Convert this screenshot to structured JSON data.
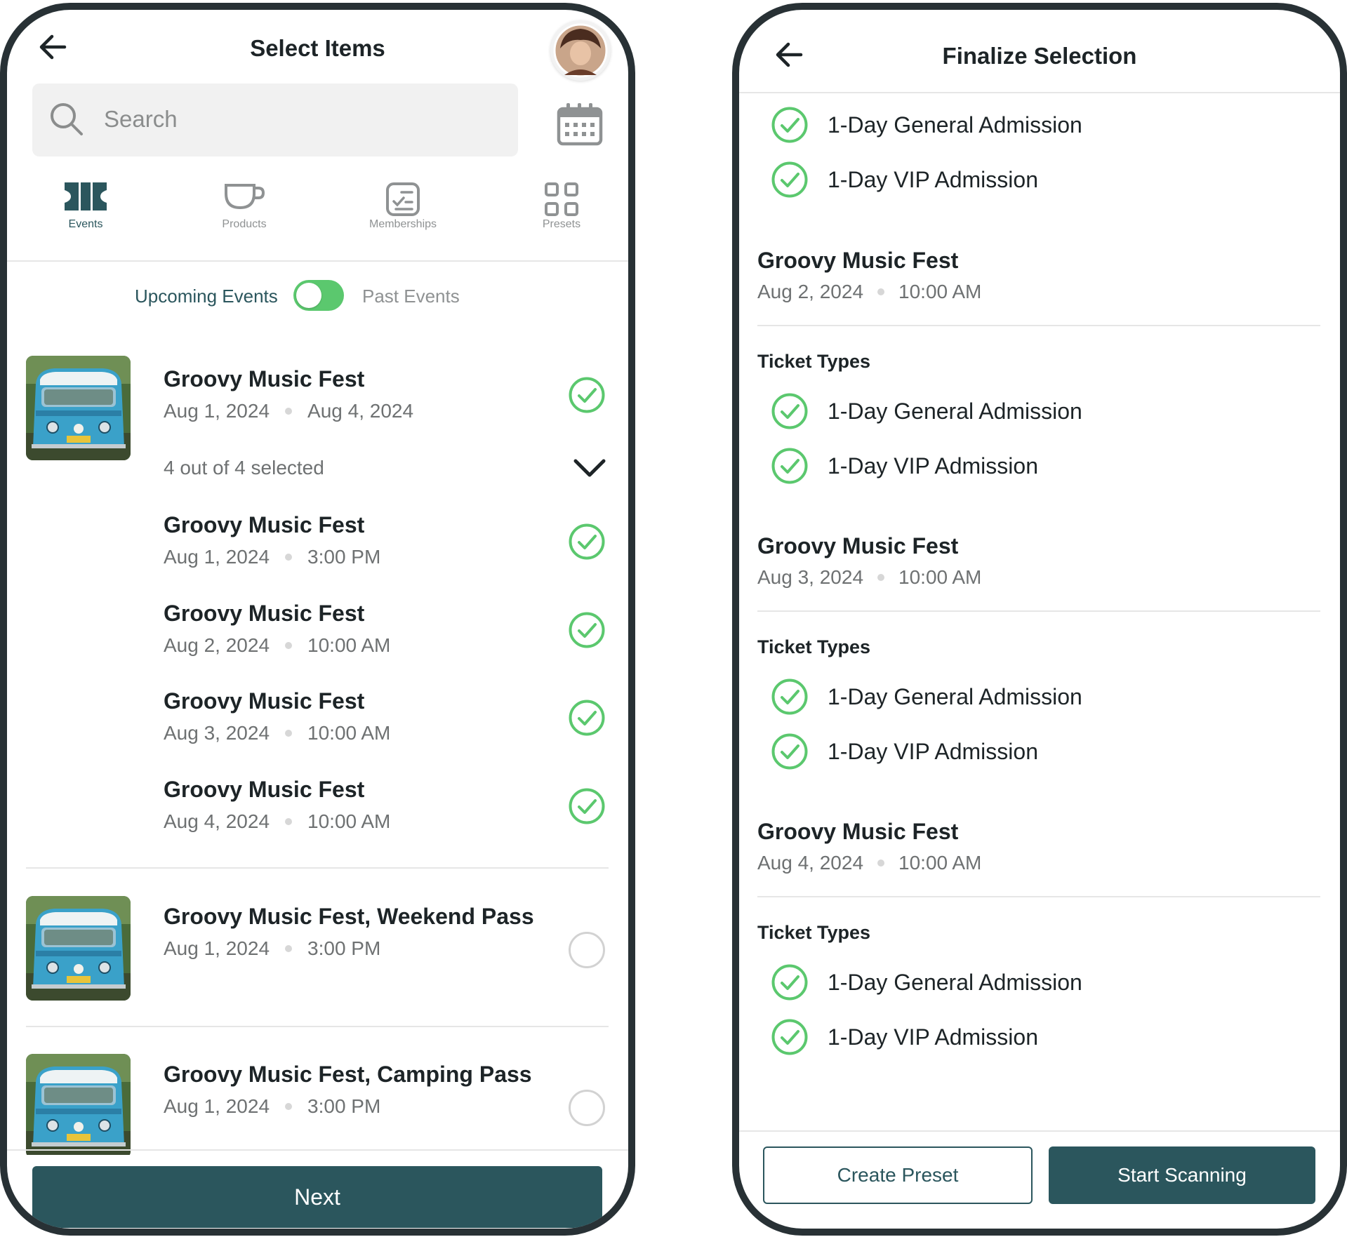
{
  "colors": {
    "accent": "#2b565d",
    "check_green": "#5bc86e",
    "frame": "#283135"
  },
  "left_screen": {
    "title": "Select Items",
    "search_placeholder": "Search",
    "tabs": [
      {
        "label": "Events",
        "icon": "ticket-icon",
        "active": true
      },
      {
        "label": "Products",
        "icon": "cup-icon",
        "active": false
      },
      {
        "label": "Memberships",
        "icon": "membership-card-icon",
        "active": false
      },
      {
        "label": "Presets",
        "icon": "grid-icon",
        "active": false
      }
    ],
    "toggle": {
      "left_label": "Upcoming Events",
      "right_label": "Past Events",
      "on": true
    },
    "group": {
      "title": "Groovy Music Fest",
      "start": "Aug 1, 2024",
      "end": "Aug 4, 2024",
      "selected_text": "4 out of 4 selected",
      "sessions": [
        {
          "title": "Groovy Music Fest",
          "date": "Aug 1, 2024",
          "time": "3:00 PM"
        },
        {
          "title": "Groovy Music Fest",
          "date": "Aug 2, 2024",
          "time": "10:00 AM"
        },
        {
          "title": "Groovy Music Fest",
          "date": "Aug 3, 2024",
          "time": "10:00 AM"
        },
        {
          "title": "Groovy Music Fest",
          "date": "Aug 4, 2024",
          "time": "10:00 AM"
        }
      ]
    },
    "others": [
      {
        "title": "Groovy Music Fest, Weekend Pass",
        "date": "Aug 1, 2024",
        "time": "3:00 PM"
      },
      {
        "title": "Groovy Music Fest, Camping Pass",
        "date": "Aug 1, 2024",
        "time": "3:00 PM"
      }
    ],
    "next_label": "Next"
  },
  "right_screen": {
    "title": "Finalize Selection",
    "top_tickets": [
      "1-Day General Admission",
      "1-Day VIP Admission"
    ],
    "ticket_types_label": "Ticket Types",
    "sections": [
      {
        "title": "Groovy Music Fest",
        "date": "Aug 2, 2024",
        "time": "10:00 AM",
        "tickets": [
          "1-Day General Admission",
          "1-Day VIP Admission"
        ]
      },
      {
        "title": "Groovy Music Fest",
        "date": "Aug 3, 2024",
        "time": "10:00 AM",
        "tickets": [
          "1-Day General Admission",
          "1-Day VIP Admission"
        ]
      },
      {
        "title": "Groovy Music Fest",
        "date": "Aug 4, 2024",
        "time": "10:00 AM",
        "tickets": [
          "1-Day General Admission",
          "1-Day VIP Admission"
        ]
      }
    ],
    "create_preset_label": "Create Preset",
    "start_scanning_label": "Start Scanning"
  }
}
